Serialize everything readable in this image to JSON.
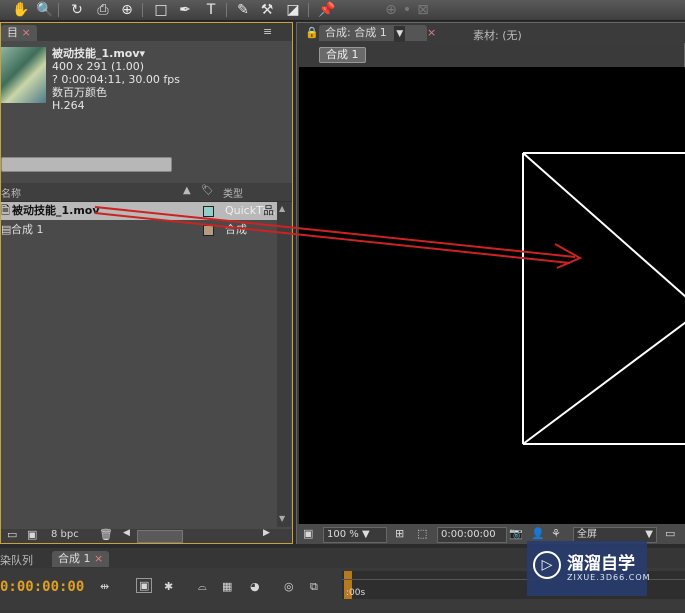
{
  "project_panel": {
    "tab_label": "目",
    "tab_close": "×",
    "menu_icon": "≡",
    "file_name": "被动技能_1.mov▾",
    "meta": [
      "400 x 291 (1.00)",
      "? 0:00:04:11, 30.00 fps",
      "数百万颜色",
      "H.264"
    ],
    "columns": {
      "name": "名称",
      "type": "类型"
    },
    "items": [
      {
        "name": "被动技能_1.mov",
        "type": "QuickTi...",
        "swatch": "#8fd0c8"
      },
      {
        "name": "合成 1",
        "type": "合成",
        "swatch": "#b59c80"
      }
    ],
    "footer": {
      "bpc": "8 bpc"
    }
  },
  "viewer": {
    "tab_comp": "合成: 合成 1",
    "tab_close": "×",
    "tab_footage": "素材: (无)",
    "sub_tab": "合成 1",
    "zoom": "100 %",
    "timecode": "0:00:00:00",
    "resolution": "全屏"
  },
  "timeline": {
    "tab_render_queue": "染队列",
    "tab_comp": "合成 1",
    "tab_close": "×",
    "timecode": "0:00:00:00",
    "ruler_label": ":00s"
  },
  "watermark": {
    "title": "溜溜自学",
    "url": "ZIXUE.3D66.COM"
  },
  "colors": {
    "accent_border": "#c9a23a",
    "timecode": "#e0a020",
    "arrow": "#cc2222"
  }
}
